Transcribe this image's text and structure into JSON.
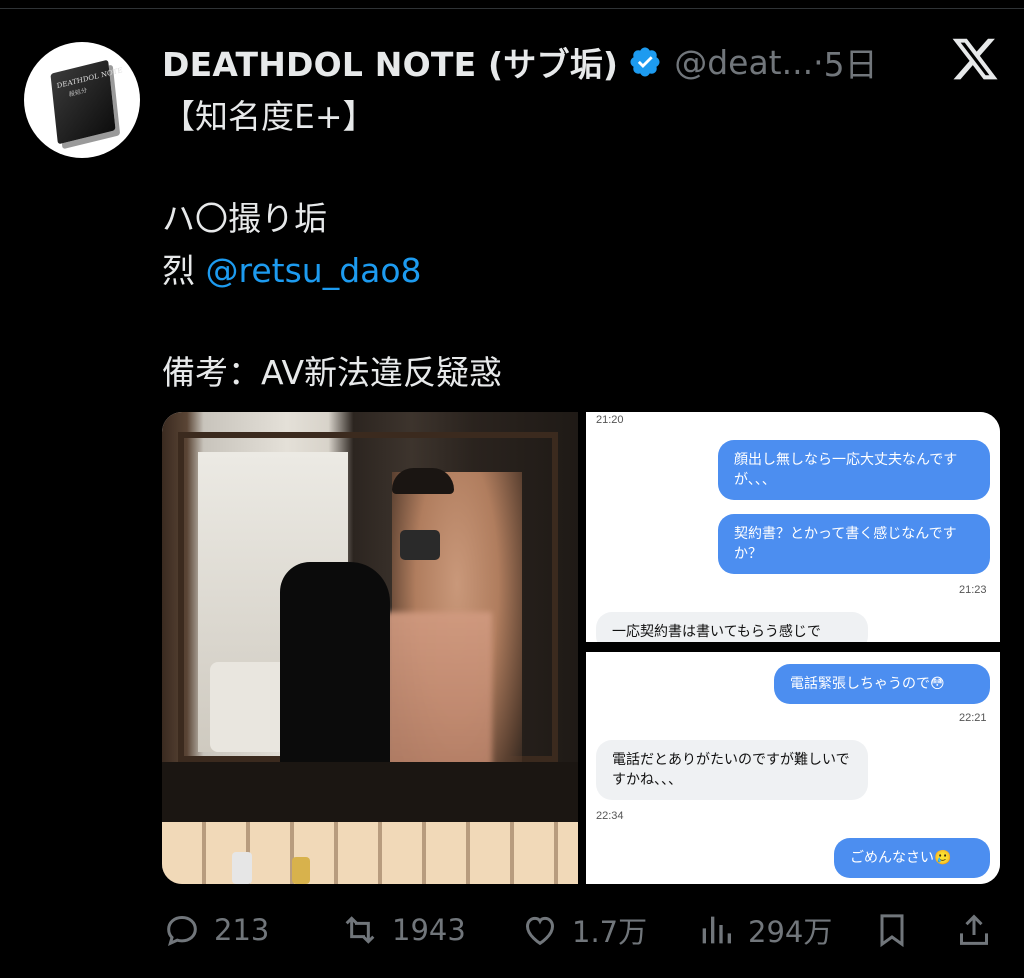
{
  "tweet": {
    "display_name": "DEATHDOL NOTE (サブ垢)",
    "handle": "@deat...",
    "separator": "·",
    "time": "5日",
    "line1": "【知名度E+】",
    "line2": "ハ〇撮り垢",
    "line3_prefix": "烈 ",
    "mention": "@retsu_dao8",
    "line4": "備考：AV新法違反疑惑"
  },
  "avatar": {
    "book_title": "DEATHDOL NOTE",
    "book_sub": "殺処分"
  },
  "chat": {
    "top": {
      "ts1": "21:20",
      "msg1": "顔出し無しなら一応大丈夫なんですが、、、",
      "msg2": "契約書？とかって書く感じなんですか？",
      "ts2": "21:23",
      "msg3": "一応契約書は書いてもらう感じで"
    },
    "bottom": {
      "msg1": "電話緊張しちゃうので😳",
      "ts1": "22:21",
      "msg2": "電話だとありがたいのですが難しいですかね、、、",
      "ts2": "22:34",
      "msg3": "ごめんなさい🥲"
    }
  },
  "actions": {
    "replies": "213",
    "reposts": "1943",
    "likes": "1.7万",
    "views": "294万"
  },
  "colors": {
    "background": "#000000",
    "text": "#e7e9ea",
    "muted": "#71767b",
    "link": "#1d9bf0",
    "verified": "#1d9bf0",
    "chat_out": "#4c8ef0",
    "chat_in": "#eff1f3"
  },
  "icons": [
    "verified-badge-icon",
    "x-logo-icon",
    "reply-icon",
    "repost-icon",
    "like-icon",
    "views-icon",
    "bookmark-icon",
    "share-icon"
  ]
}
